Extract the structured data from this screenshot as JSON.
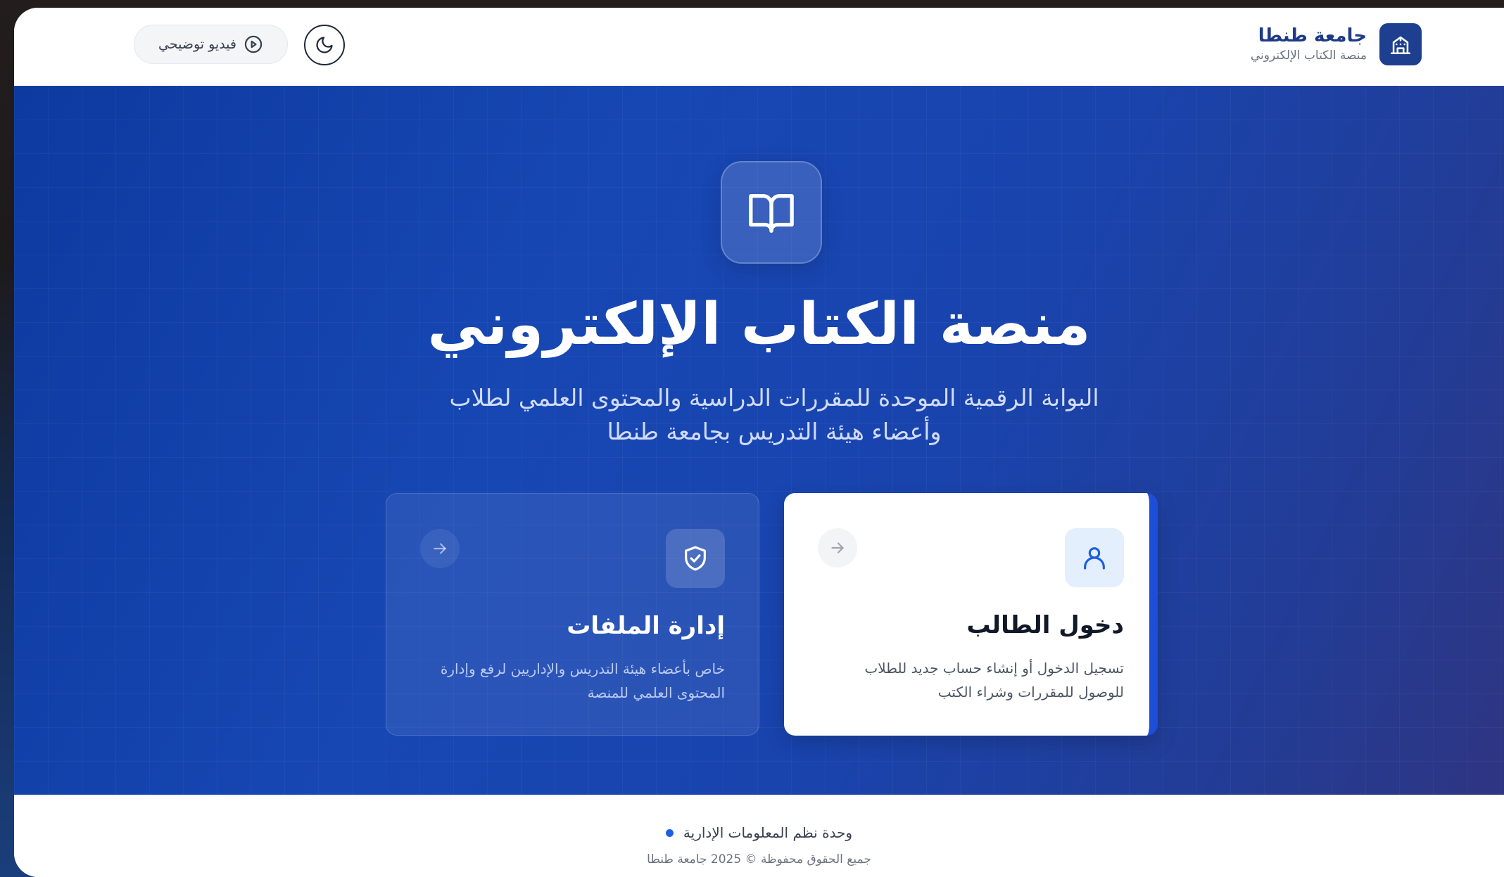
{
  "header": {
    "brand_title": "جامعة طنطا",
    "brand_subtitle": "منصة الكتاب الإلكتروني",
    "video_button_label": "فيديو توضيحي"
  },
  "hero": {
    "title": "منصة الكتاب الإلكتروني",
    "subtitle": "البوابة الرقمية الموحدة للمقررات الدراسية والمحتوى العلمي لطلاب وأعضاء هيئة التدريس بجامعة طنطا"
  },
  "cards": {
    "student": {
      "title": "دخول الطالب",
      "description": "تسجيل الدخول أو إنشاء حساب جديد للطلاب للوصول للمقررات وشراء الكتب"
    },
    "files": {
      "title": "إدارة الملفات",
      "description": "خاص بأعضاء هيئة التدريس والإداريين لرفع وإدارة المحتوى العلمي للمنصة"
    }
  },
  "footer": {
    "unit": "وحدة نظم المعلومات الإدارية",
    "copyright": "جميع الحقوق محفوظة © 2025 جامعة طنطا"
  },
  "icons": {
    "brand_logo": "university-building-icon",
    "theme_toggle": "moon-icon",
    "video": "play-circle-icon",
    "hero_badge": "open-book-icon",
    "student_card": "user-icon",
    "files_card": "shield-check-icon",
    "card_arrow": "arrow-right-icon"
  },
  "colors": {
    "brand_navy": "#1e3f8f",
    "hero_blue": "#1747b3",
    "accent_blue": "#1d4ed8",
    "footer_dot": "#1d5fe0"
  }
}
